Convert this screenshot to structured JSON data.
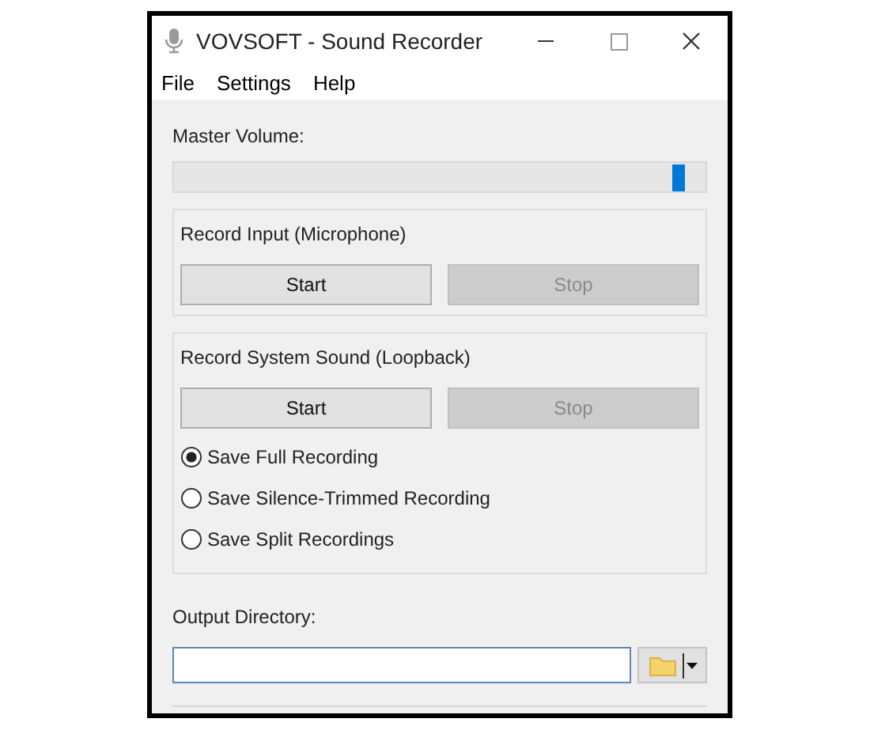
{
  "window": {
    "title": "VOVSOFT - Sound Recorder"
  },
  "menu": [
    "File",
    "Settings",
    "Help"
  ],
  "master_volume": {
    "label": "Master Volume:",
    "level": 0.95
  },
  "groups": [
    {
      "title": "Record Input (Microphone)",
      "buttons": [
        {
          "label": "Start",
          "disabled": false
        },
        {
          "label": "Stop",
          "disabled": true
        }
      ]
    },
    {
      "title": "Record System Sound (Loopback)",
      "buttons": [
        {
          "label": "Start",
          "disabled": false
        },
        {
          "label": "Stop",
          "disabled": true
        }
      ],
      "options": [
        {
          "label": "Save Full Recording",
          "selected": true
        },
        {
          "label": "Save Silence-Trimmed Recording",
          "selected": false
        },
        {
          "label": "Save Split Recordings",
          "selected": false
        }
      ]
    }
  ],
  "output": {
    "label": "Output Directory:"
  }
}
